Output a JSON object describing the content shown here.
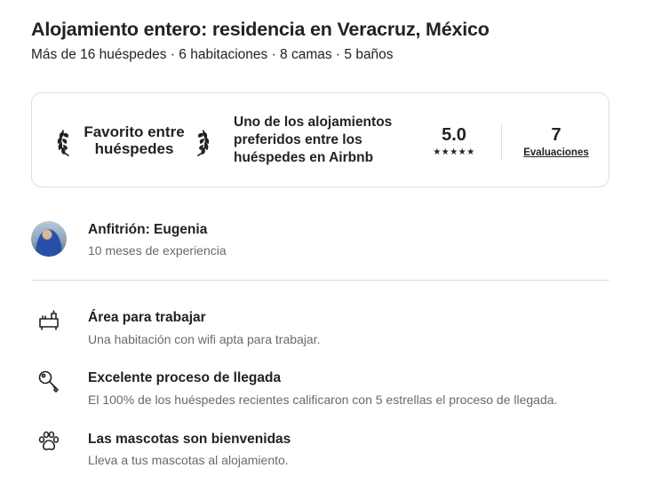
{
  "listing": {
    "title": "Alojamiento entero: residencia en Veracruz, México",
    "summary": "Más de 16 huéspedes · 6 habitaciones · 8 camas · 5 baños"
  },
  "favorite": {
    "label": "Favorito entre huéspedes",
    "description": "Uno de los alojamientos preferidos entre los huéspedes en Airbnb",
    "rating": "5.0",
    "stars": "★★★★★",
    "reviews_count": "7",
    "reviews_label": "Evaluaciones"
  },
  "host": {
    "name": "Anfitrión: Eugenia",
    "experience": "10 meses de experiencia"
  },
  "features": [
    {
      "icon": "workspace-icon",
      "title": "Área para trabajar",
      "description": "Una habitación con wifi apta para trabajar."
    },
    {
      "icon": "key-icon",
      "title": "Excelente proceso de llegada",
      "description": "El 100% de los huéspedes recientes calificaron con 5 estrellas el proceso de llegada."
    },
    {
      "icon": "paw-icon",
      "title": "Las mascotas son bienvenidas",
      "description": "Lleva a tus mascotas al alojamiento."
    }
  ]
}
